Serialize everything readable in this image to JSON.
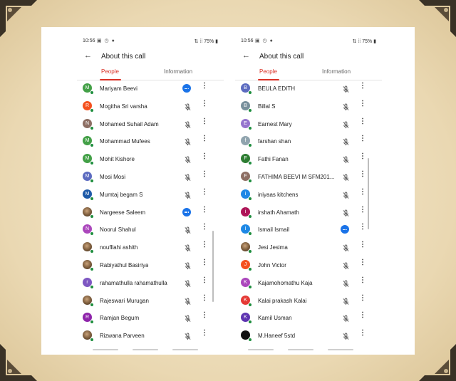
{
  "left_phone": {
    "status": {
      "time": "10:56",
      "status_icons": "▣ ◷ ●",
      "right": "⇅ ⁞⁞ 75% ▮"
    },
    "header": {
      "back": "←",
      "title": "About this call"
    },
    "tabs": {
      "people": "People",
      "information": "Information"
    },
    "participants": [
      {
        "initial": "M",
        "name": "Mariyam Beevi",
        "color": "#43a047",
        "mic": "speaking"
      },
      {
        "initial": "R",
        "name": "Mogitha Sri varsha",
        "color": "#f4511e",
        "mic": "muted"
      },
      {
        "initial": "N",
        "name": "Mohamed Suhail Adam",
        "color": "#8d6e63",
        "mic": "muted"
      },
      {
        "initial": "M",
        "name": "Mohammad Mufees",
        "color": "#43a047",
        "mic": "muted"
      },
      {
        "initial": "M",
        "name": "Mohit Kishore",
        "color": "#43a047",
        "mic": "muted"
      },
      {
        "initial": "M",
        "name": "Mosi Mosi",
        "color": "#5c6bc0",
        "mic": "muted"
      },
      {
        "initial": "M",
        "name": "Mumtaj begam S",
        "color": "#1e5aa8",
        "mic": "muted"
      },
      {
        "initial": "",
        "name": "Nargeese Saleem",
        "color": "",
        "photo": true,
        "mic": "dots"
      },
      {
        "initial": "N",
        "name": "Noorul Shahul",
        "color": "#ab47bc",
        "mic": "muted"
      },
      {
        "initial": "",
        "name": "noufllahi ashith",
        "color": "",
        "photo": true,
        "mic": "muted"
      },
      {
        "initial": "",
        "name": "Rabiyathul Basiriya",
        "color": "",
        "photo": true,
        "mic": "muted"
      },
      {
        "initial": "r",
        "name": "rahamathulla rahamathulla",
        "color": "#7e57c2",
        "mic": "muted"
      },
      {
        "initial": "",
        "name": "Rajeswari Murugan",
        "color": "",
        "photo": true,
        "mic": "muted"
      },
      {
        "initial": "R",
        "name": "Ramjan Begum",
        "color": "#8e24aa",
        "mic": "muted"
      },
      {
        "initial": "",
        "name": "Rizwana Parveen",
        "color": "",
        "photo": true,
        "mic": "muted"
      }
    ]
  },
  "right_phone": {
    "status": {
      "time": "10:56",
      "status_icons": "▣ ◷ ●",
      "right": "⇅ ⁞⁞ 75% ▮"
    },
    "header": {
      "back": "←",
      "title": "About this call"
    },
    "tabs": {
      "people": "People",
      "information": "Information"
    },
    "participants": [
      {
        "initial": "B",
        "name": "BEULA EDITH",
        "color": "#5c6bc0",
        "mic": "muted"
      },
      {
        "initial": "B",
        "name": "Billal S",
        "color": "#78909c",
        "mic": "muted"
      },
      {
        "initial": "E",
        "name": "Earnest Mary",
        "color": "#9575cd",
        "mic": "muted"
      },
      {
        "initial": "f",
        "name": "farshan shan",
        "color": "#90a4ae",
        "mic": "muted"
      },
      {
        "initial": "F",
        "name": "Fathi Fanan",
        "color": "#2e7d32",
        "mic": "muted"
      },
      {
        "initial": "F",
        "name": "FATHIMA BEEVI M SFM201...",
        "color": "#8d6e63",
        "mic": "muted"
      },
      {
        "initial": "i",
        "name": "iniyaas kitchens",
        "color": "#1e88e5",
        "mic": "muted"
      },
      {
        "initial": "i",
        "name": "irshath Ahamath",
        "color": "#ad1457",
        "mic": "muted"
      },
      {
        "initial": "I",
        "name": "Ismail Ismail",
        "color": "#1e88e5",
        "mic": "dots"
      },
      {
        "initial": "",
        "name": "Jesi Jesima",
        "color": "",
        "photo": true,
        "mic": "muted"
      },
      {
        "initial": "J",
        "name": "John Victor",
        "color": "#f4511e",
        "mic": "muted"
      },
      {
        "initial": "K",
        "name": "Kajamohomathu Kaja",
        "color": "#ab47bc",
        "mic": "muted"
      },
      {
        "initial": "K",
        "name": "Kalai prakash Kalai",
        "color": "#e53935",
        "mic": "muted"
      },
      {
        "initial": "K",
        "name": "Kamil Usman",
        "color": "#5e35b1",
        "mic": "muted"
      },
      {
        "initial": "",
        "name": "M.Haneef 5std",
        "color": "#111111",
        "mic": "muted"
      }
    ]
  },
  "icons": {
    "more": "more-vert-icon",
    "mic": "mic-off-icon",
    "speaking": "speaking-indicator-icon"
  }
}
